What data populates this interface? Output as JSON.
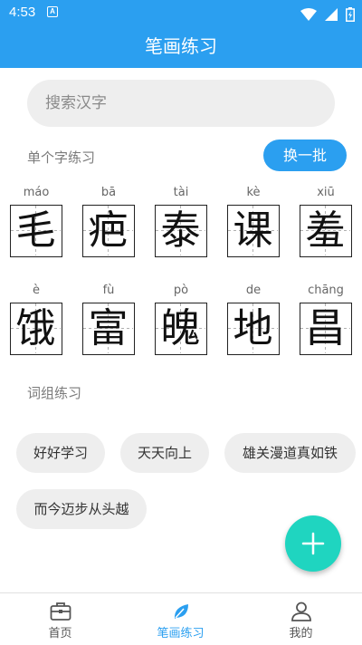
{
  "status_bar": {
    "time": "4:53",
    "notification_icon": "A"
  },
  "app_bar": {
    "title": "笔画练习"
  },
  "search": {
    "placeholder": "搜索汉字"
  },
  "single_section": {
    "title": "单个字练习",
    "refresh_label": "换一批"
  },
  "characters": [
    {
      "pinyin": "máo",
      "char": "毛"
    },
    {
      "pinyin": "bā",
      "char": "疤"
    },
    {
      "pinyin": "tài",
      "char": "泰"
    },
    {
      "pinyin": "kè",
      "char": "课"
    },
    {
      "pinyin": "xiū",
      "char": "羞"
    },
    {
      "pinyin": "è",
      "char": "饿"
    },
    {
      "pinyin": "fù",
      "char": "富"
    },
    {
      "pinyin": "pò",
      "char": "魄"
    },
    {
      "pinyin": "de",
      "char": "地"
    },
    {
      "pinyin": "chāng",
      "char": "昌"
    }
  ],
  "phrase_section": {
    "title": "词组练习"
  },
  "phrases": [
    "好好学习",
    "天天向上",
    "雄关漫道真如铁",
    "而今迈步从头越"
  ],
  "bottom_nav": {
    "items": [
      {
        "label": "首页",
        "icon": "toolbox-icon"
      },
      {
        "label": "笔画练习",
        "icon": "leaf-icon"
      },
      {
        "label": "我的",
        "icon": "person-icon"
      }
    ],
    "active_index": 1
  },
  "colors": {
    "primary": "#2b9ff0",
    "fab": "#1fd5c0",
    "chip_bg": "#eeeeee"
  }
}
